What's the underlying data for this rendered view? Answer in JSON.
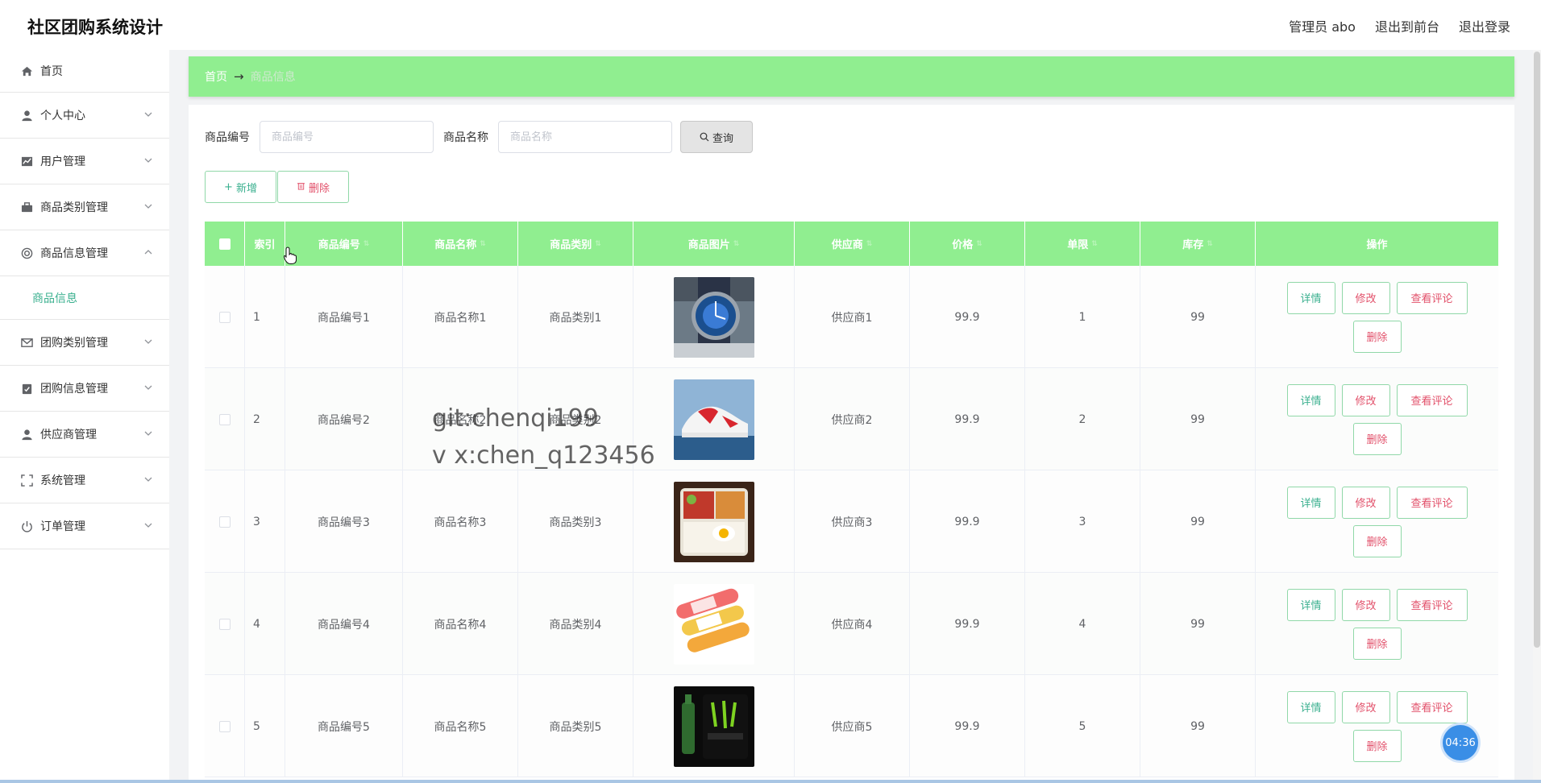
{
  "header": {
    "title": "社区团购系统设计",
    "admin_label": "管理员 abo",
    "front_label": "退出到前台",
    "logout_label": "退出登录"
  },
  "sidebar": {
    "items": [
      {
        "label": "首页",
        "icon": "home-icon"
      },
      {
        "label": "个人中心",
        "icon": "user-icon"
      },
      {
        "label": "用户管理",
        "icon": "chart-icon"
      },
      {
        "label": "商品类别管理",
        "icon": "briefcase-icon"
      },
      {
        "label": "商品信息管理",
        "icon": "lifebuoy-icon"
      },
      {
        "label": "团购类别管理",
        "icon": "mail-icon"
      },
      {
        "label": "团购信息管理",
        "icon": "clipboard-icon"
      },
      {
        "label": "供应商管理",
        "icon": "user-icon"
      },
      {
        "label": "系统管理",
        "icon": "frame-icon"
      },
      {
        "label": "订单管理",
        "icon": "power-icon"
      }
    ],
    "sub_item": "商品信息"
  },
  "breadcrumb": {
    "home": "首页",
    "arrow": "→",
    "current": "商品信息"
  },
  "search": {
    "code_label": "商品编号",
    "code_placeholder": "商品编号",
    "name_label": "商品名称",
    "name_placeholder": "商品名称",
    "query_label": "查询"
  },
  "actions": {
    "add_label": "新增",
    "delete_label": "删除"
  },
  "table": {
    "headers": [
      "索引",
      "商品编号",
      "商品名称",
      "商品类别",
      "商品图片",
      "供应商",
      "价格",
      "单限",
      "库存",
      "操作"
    ],
    "rows": [
      {
        "index": "1",
        "code": "商品编号1",
        "name": "商品名称1",
        "category": "商品类别1",
        "image": "watch",
        "supplier": "供应商1",
        "price": "99.9",
        "limit": "1",
        "stock": "99"
      },
      {
        "index": "2",
        "code": "商品编号2",
        "name": "商品名称2",
        "category": "商品类别2",
        "image": "shoe",
        "supplier": "供应商2",
        "price": "99.9",
        "limit": "2",
        "stock": "99"
      },
      {
        "index": "3",
        "code": "商品编号3",
        "name": "商品名称3",
        "category": "商品类别3",
        "image": "bento",
        "supplier": "供应商3",
        "price": "99.9",
        "limit": "3",
        "stock": "99"
      },
      {
        "index": "4",
        "code": "商品编号4",
        "name": "商品名称4",
        "category": "商品类别4",
        "image": "snack",
        "supplier": "供应商4",
        "price": "99.9",
        "limit": "4",
        "stock": "99"
      },
      {
        "index": "5",
        "code": "商品编号5",
        "name": "商品名称5",
        "category": "商品类别5",
        "image": "drink",
        "supplier": "供应商5",
        "price": "99.9",
        "limit": "5",
        "stock": "99"
      }
    ],
    "op_detail": "详情",
    "op_edit": "修改",
    "op_review": "查看评论",
    "op_delete": "删除"
  },
  "watermark": {
    "line1": "git:chenqi199",
    "line2": "v x:chen_q123456"
  },
  "timer": "04:36",
  "colors": {
    "accent_green": "#90ee90",
    "text_green": "#3bb08f",
    "danger_pink": "#e2506a"
  }
}
